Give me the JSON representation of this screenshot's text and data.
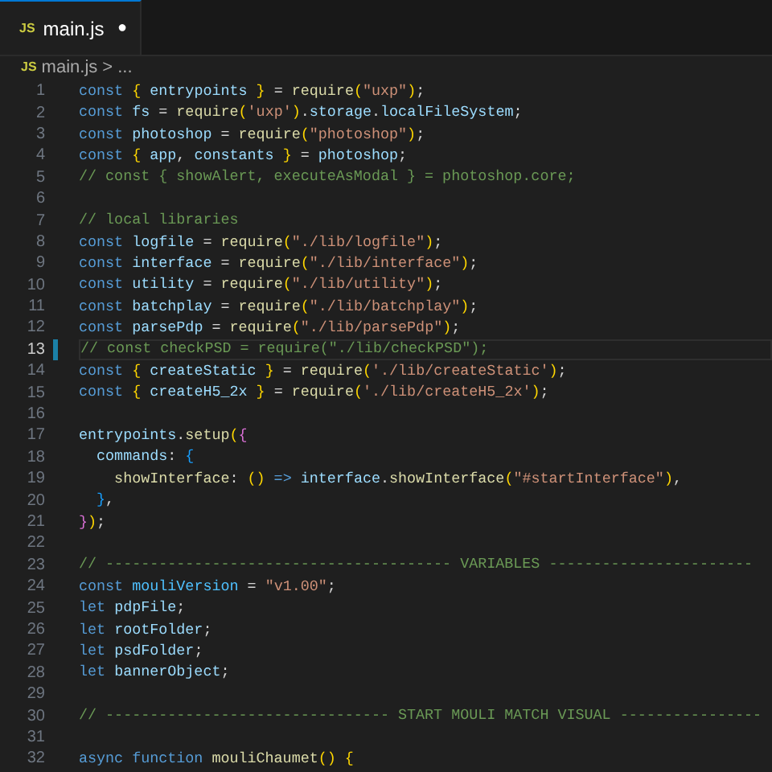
{
  "tabs": [
    {
      "icon_text": "JS",
      "label": "main.js",
      "selected": true,
      "modified": true,
      "dirty_mark": "●"
    }
  ],
  "breadcrumb": {
    "icon_text": "JS",
    "file": "main.js",
    "separator": ">",
    "more": "..."
  },
  "editor": {
    "lines": [
      {
        "number": "1",
        "selected": false,
        "tokens": [
          {
            "kind": "kw",
            "text": "const "
          },
          {
            "kind": "br1",
            "text": "{"
          },
          {
            "kind": "var",
            "text": " entrypoints "
          },
          {
            "kind": "br1",
            "text": "}"
          },
          {
            "kind": "punc",
            "text": " = "
          },
          {
            "kind": "fn",
            "text": "require"
          },
          {
            "kind": "br1",
            "text": "("
          },
          {
            "kind": "str",
            "text": "\"uxp\""
          },
          {
            "kind": "br1",
            "text": ")"
          },
          {
            "kind": "punc",
            "text": ";"
          }
        ]
      },
      {
        "number": "2",
        "selected": false,
        "tokens": [
          {
            "kind": "kw",
            "text": "const "
          },
          {
            "kind": "var",
            "text": "fs"
          },
          {
            "kind": "punc",
            "text": " = "
          },
          {
            "kind": "fn",
            "text": "require"
          },
          {
            "kind": "br1",
            "text": "("
          },
          {
            "kind": "str",
            "text": "'uxp'"
          },
          {
            "kind": "br1",
            "text": ")"
          },
          {
            "kind": "punc",
            "text": "."
          },
          {
            "kind": "var",
            "text": "storage"
          },
          {
            "kind": "punc",
            "text": "."
          },
          {
            "kind": "var",
            "text": "localFileSystem"
          },
          {
            "kind": "punc",
            "text": ";"
          }
        ]
      },
      {
        "number": "3",
        "selected": false,
        "tokens": [
          {
            "kind": "kw",
            "text": "const "
          },
          {
            "kind": "var",
            "text": "photoshop"
          },
          {
            "kind": "punc",
            "text": " = "
          },
          {
            "kind": "fn",
            "text": "require"
          },
          {
            "kind": "br1",
            "text": "("
          },
          {
            "kind": "str",
            "text": "\"photoshop\""
          },
          {
            "kind": "br1",
            "text": ")"
          },
          {
            "kind": "punc",
            "text": ";"
          }
        ]
      },
      {
        "number": "4",
        "selected": false,
        "tokens": [
          {
            "kind": "kw",
            "text": "const "
          },
          {
            "kind": "br1",
            "text": "{"
          },
          {
            "kind": "var",
            "text": " app"
          },
          {
            "kind": "punc",
            "text": ", "
          },
          {
            "kind": "var",
            "text": "constants "
          },
          {
            "kind": "br1",
            "text": "}"
          },
          {
            "kind": "punc",
            "text": " = "
          },
          {
            "kind": "var",
            "text": "photoshop"
          },
          {
            "kind": "punc",
            "text": ";"
          }
        ]
      },
      {
        "number": "5",
        "selected": false,
        "tokens": [
          {
            "kind": "cmt",
            "text": "// const { showAlert, executeAsModal } = photoshop.core;"
          }
        ]
      },
      {
        "number": "6",
        "selected": false
      },
      {
        "number": "7",
        "selected": false,
        "tokens": [
          {
            "kind": "cmt",
            "text": "// local libraries"
          }
        ]
      },
      {
        "number": "8",
        "selected": false,
        "tokens": [
          {
            "kind": "kw",
            "text": "const "
          },
          {
            "kind": "var",
            "text": "logfile"
          },
          {
            "kind": "punc",
            "text": " = "
          },
          {
            "kind": "fn",
            "text": "require"
          },
          {
            "kind": "br1",
            "text": "("
          },
          {
            "kind": "str",
            "text": "\"./lib/logfile\""
          },
          {
            "kind": "br1",
            "text": ")"
          },
          {
            "kind": "punc",
            "text": ";"
          }
        ]
      },
      {
        "number": "9",
        "selected": false,
        "tokens": [
          {
            "kind": "kw",
            "text": "const "
          },
          {
            "kind": "var",
            "text": "interface"
          },
          {
            "kind": "punc",
            "text": " = "
          },
          {
            "kind": "fn",
            "text": "require"
          },
          {
            "kind": "br1",
            "text": "("
          },
          {
            "kind": "str",
            "text": "\"./lib/interface\""
          },
          {
            "kind": "br1",
            "text": ")"
          },
          {
            "kind": "punc",
            "text": ";"
          }
        ]
      },
      {
        "number": "10",
        "selected": false,
        "tokens": [
          {
            "kind": "kw",
            "text": "const "
          },
          {
            "kind": "var",
            "text": "utility"
          },
          {
            "kind": "punc",
            "text": " = "
          },
          {
            "kind": "fn",
            "text": "require"
          },
          {
            "kind": "br1",
            "text": "("
          },
          {
            "kind": "str",
            "text": "\"./lib/utility\""
          },
          {
            "kind": "br1",
            "text": ")"
          },
          {
            "kind": "punc",
            "text": ";"
          }
        ]
      },
      {
        "number": "11",
        "selected": false,
        "tokens": [
          {
            "kind": "kw",
            "text": "const "
          },
          {
            "kind": "var",
            "text": "batchplay"
          },
          {
            "kind": "punc",
            "text": " = "
          },
          {
            "kind": "fn",
            "text": "require"
          },
          {
            "kind": "br1",
            "text": "("
          },
          {
            "kind": "str",
            "text": "\"./lib/batchplay\""
          },
          {
            "kind": "br1",
            "text": ")"
          },
          {
            "kind": "punc",
            "text": ";"
          }
        ]
      },
      {
        "number": "12",
        "selected": false,
        "tokens": [
          {
            "kind": "kw",
            "text": "const "
          },
          {
            "kind": "var",
            "text": "parsePdp"
          },
          {
            "kind": "punc",
            "text": " = "
          },
          {
            "kind": "fn",
            "text": "require"
          },
          {
            "kind": "br1",
            "text": "("
          },
          {
            "kind": "str",
            "text": "\"./lib/parsePdp\""
          },
          {
            "kind": "br1",
            "text": ")"
          },
          {
            "kind": "punc",
            "text": ";"
          }
        ]
      },
      {
        "number": "13",
        "selected": true,
        "tokens": [
          {
            "kind": "cmt",
            "text": "// const checkPSD = require(\"./lib/checkPSD\");"
          }
        ]
      },
      {
        "number": "14",
        "selected": false,
        "tokens": [
          {
            "kind": "kw",
            "text": "const "
          },
          {
            "kind": "br1",
            "text": "{"
          },
          {
            "kind": "var",
            "text": " createStatic "
          },
          {
            "kind": "br1",
            "text": "}"
          },
          {
            "kind": "punc",
            "text": " = "
          },
          {
            "kind": "fn",
            "text": "require"
          },
          {
            "kind": "br1",
            "text": "("
          },
          {
            "kind": "str",
            "text": "'./lib/createStatic'"
          },
          {
            "kind": "br1",
            "text": ")"
          },
          {
            "kind": "punc",
            "text": ";"
          }
        ]
      },
      {
        "number": "15",
        "selected": false,
        "tokens": [
          {
            "kind": "kw",
            "text": "const "
          },
          {
            "kind": "br1",
            "text": "{"
          },
          {
            "kind": "var",
            "text": " createH5_2x "
          },
          {
            "kind": "br1",
            "text": "}"
          },
          {
            "kind": "punc",
            "text": " = "
          },
          {
            "kind": "fn",
            "text": "require"
          },
          {
            "kind": "br1",
            "text": "("
          },
          {
            "kind": "str",
            "text": "'./lib/createH5_2x'"
          },
          {
            "kind": "br1",
            "text": ")"
          },
          {
            "kind": "punc",
            "text": ";"
          }
        ]
      },
      {
        "number": "16",
        "selected": false
      },
      {
        "number": "17",
        "selected": false,
        "tokens": [
          {
            "kind": "var",
            "text": "entrypoints"
          },
          {
            "kind": "punc",
            "text": "."
          },
          {
            "kind": "fn",
            "text": "setup"
          },
          {
            "kind": "br1",
            "text": "("
          },
          {
            "kind": "br2",
            "text": "{"
          }
        ]
      },
      {
        "number": "18",
        "selected": false,
        "tokens": [
          {
            "kind": "var",
            "text": "  commands"
          },
          {
            "kind": "punc",
            "text": ": "
          },
          {
            "kind": "br3",
            "text": "{"
          }
        ]
      },
      {
        "number": "19",
        "selected": false,
        "tokens": [
          {
            "kind": "fn",
            "text": "    showInterface"
          },
          {
            "kind": "punc",
            "text": ": "
          },
          {
            "kind": "br1",
            "text": "()"
          },
          {
            "kind": "kw",
            "text": " => "
          },
          {
            "kind": "var",
            "text": "interface"
          },
          {
            "kind": "punc",
            "text": "."
          },
          {
            "kind": "fn",
            "text": "showInterface"
          },
          {
            "kind": "br1",
            "text": "("
          },
          {
            "kind": "str",
            "text": "\"#startInterface\""
          },
          {
            "kind": "br1",
            "text": ")"
          },
          {
            "kind": "punc",
            "text": ","
          }
        ]
      },
      {
        "number": "20",
        "selected": false,
        "tokens": [
          {
            "kind": "br3",
            "text": "  }"
          },
          {
            "kind": "punc",
            "text": ","
          }
        ]
      },
      {
        "number": "21",
        "selected": false,
        "tokens": [
          {
            "kind": "br2",
            "text": "}"
          },
          {
            "kind": "br1",
            "text": ")"
          },
          {
            "kind": "punc",
            "text": ";"
          }
        ]
      },
      {
        "number": "22",
        "selected": false
      },
      {
        "number": "23",
        "selected": false,
        "tokens": [
          {
            "kind": "cmt",
            "text": "// --------------------------------------- VARIABLES -----------------------"
          }
        ]
      },
      {
        "number": "24",
        "selected": false,
        "tokens": [
          {
            "kind": "kw",
            "text": "const "
          },
          {
            "kind": "const",
            "text": "mouliVersion"
          },
          {
            "kind": "punc",
            "text": " = "
          },
          {
            "kind": "str",
            "text": "\"v1.00\""
          },
          {
            "kind": "punc",
            "text": ";"
          }
        ]
      },
      {
        "number": "25",
        "selected": false,
        "tokens": [
          {
            "kind": "kw",
            "text": "let "
          },
          {
            "kind": "var",
            "text": "pdpFile"
          },
          {
            "kind": "punc",
            "text": ";"
          }
        ]
      },
      {
        "number": "26",
        "selected": false,
        "tokens": [
          {
            "kind": "kw",
            "text": "let "
          },
          {
            "kind": "var",
            "text": "rootFolder"
          },
          {
            "kind": "punc",
            "text": ";"
          }
        ]
      },
      {
        "number": "27",
        "selected": false,
        "tokens": [
          {
            "kind": "kw",
            "text": "let "
          },
          {
            "kind": "var",
            "text": "psdFolder"
          },
          {
            "kind": "punc",
            "text": ";"
          }
        ]
      },
      {
        "number": "28",
        "selected": false,
        "tokens": [
          {
            "kind": "kw",
            "text": "let "
          },
          {
            "kind": "var",
            "text": "bannerObject"
          },
          {
            "kind": "punc",
            "text": ";"
          }
        ]
      },
      {
        "number": "29",
        "selected": false
      },
      {
        "number": "30",
        "selected": false,
        "tokens": [
          {
            "kind": "cmt",
            "text": "// -------------------------------- START MOULI MATCH VISUAL ----------------"
          }
        ]
      },
      {
        "number": "31",
        "selected": false
      },
      {
        "number": "32",
        "selected": false,
        "tokens": [
          {
            "kind": "kw",
            "text": "async function "
          },
          {
            "kind": "fn",
            "text": "mouliChaumet"
          },
          {
            "kind": "br1",
            "text": "()"
          },
          {
            "kind": "br1",
            "text": " {"
          }
        ]
      }
    ]
  }
}
